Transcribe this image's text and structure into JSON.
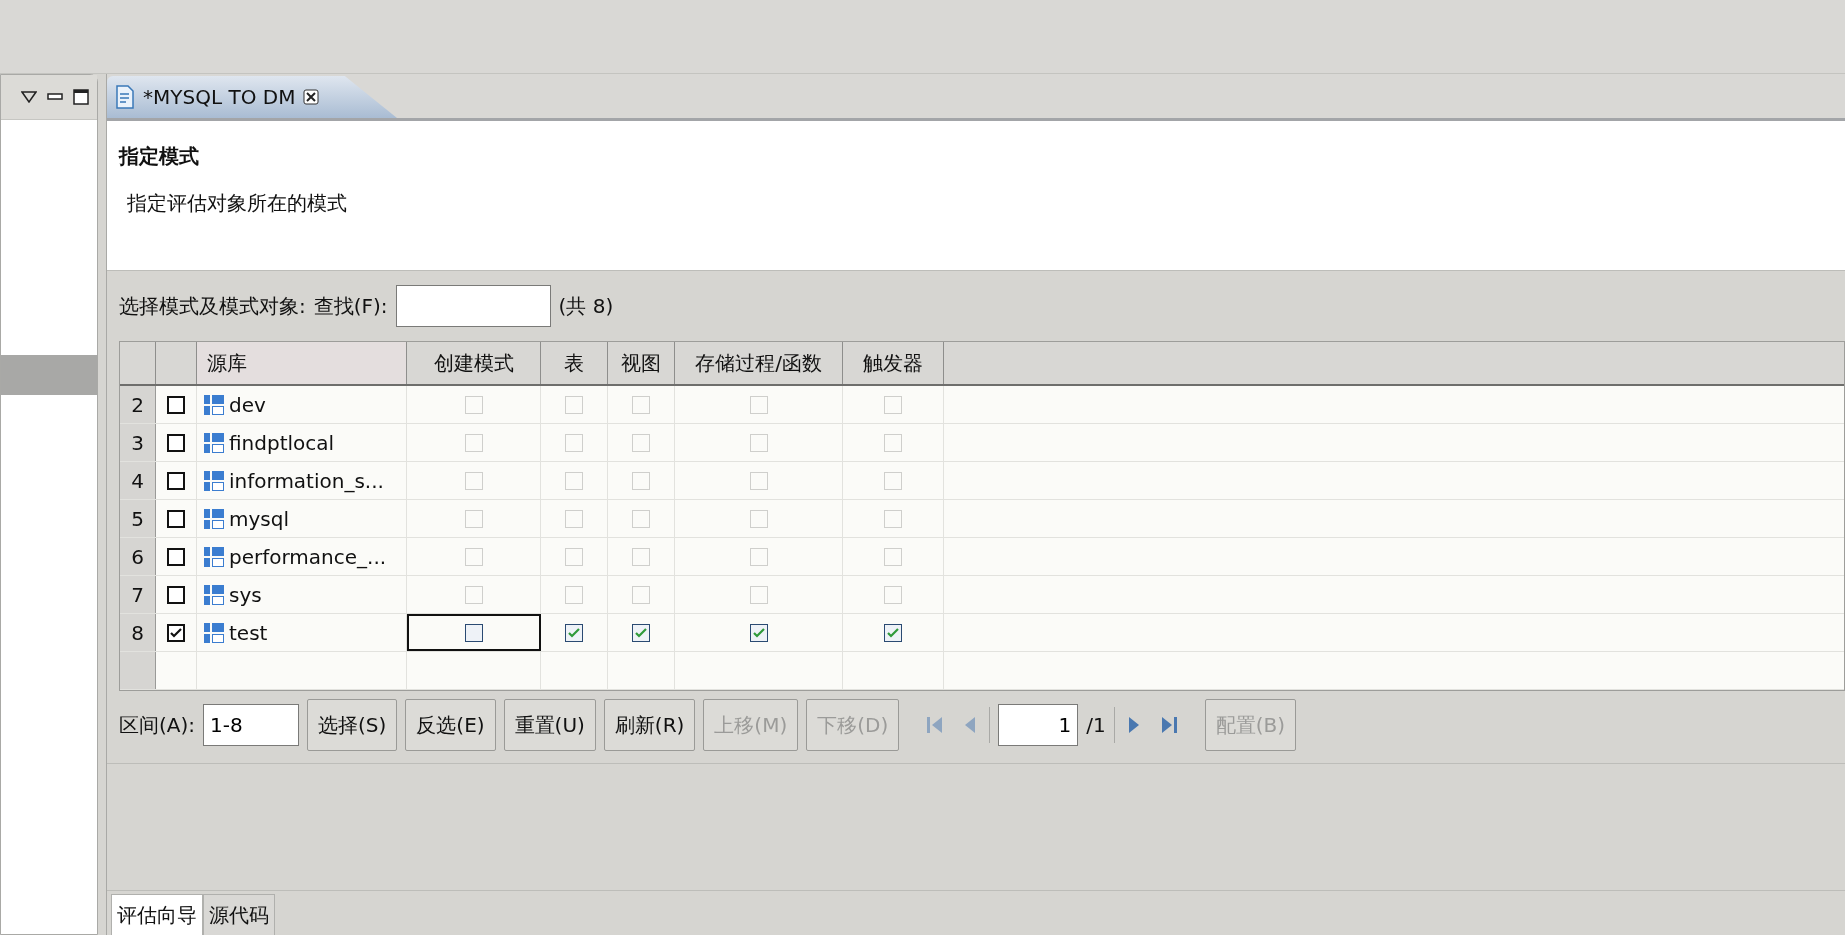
{
  "side_panel": {
    "selected_row": true
  },
  "editor_tab": {
    "title": "*MYSQL TO DM"
  },
  "header": {
    "title": "指定模式",
    "description": "指定评估对象所在的模式"
  },
  "search": {
    "label": "选择模式及模式对象:",
    "find_label": "查找(F):",
    "count": "(共 8)"
  },
  "table": {
    "columns": [
      "源库",
      "创建模式",
      "表",
      "视图",
      "存储过程/函数",
      "触发器"
    ],
    "rows": [
      {
        "number": "2",
        "checked": false,
        "name": "dev",
        "cells": [
          {
            "checked": false,
            "disabled": true,
            "focused": false
          },
          {
            "checked": false,
            "disabled": true,
            "focused": false
          },
          {
            "checked": false,
            "disabled": true,
            "focused": false
          },
          {
            "checked": false,
            "disabled": true,
            "focused": false
          },
          {
            "checked": false,
            "disabled": true,
            "focused": false
          }
        ]
      },
      {
        "number": "3",
        "checked": false,
        "name": "findptlocal",
        "cells": [
          {
            "checked": false,
            "disabled": true,
            "focused": false
          },
          {
            "checked": false,
            "disabled": true,
            "focused": false
          },
          {
            "checked": false,
            "disabled": true,
            "focused": false
          },
          {
            "checked": false,
            "disabled": true,
            "focused": false
          },
          {
            "checked": false,
            "disabled": true,
            "focused": false
          }
        ]
      },
      {
        "number": "4",
        "checked": false,
        "name": "information_s...",
        "cells": [
          {
            "checked": false,
            "disabled": true,
            "focused": false
          },
          {
            "checked": false,
            "disabled": true,
            "focused": false
          },
          {
            "checked": false,
            "disabled": true,
            "focused": false
          },
          {
            "checked": false,
            "disabled": true,
            "focused": false
          },
          {
            "checked": false,
            "disabled": true,
            "focused": false
          }
        ]
      },
      {
        "number": "5",
        "checked": false,
        "name": "mysql",
        "cells": [
          {
            "checked": false,
            "disabled": true,
            "focused": false
          },
          {
            "checked": false,
            "disabled": true,
            "focused": false
          },
          {
            "checked": false,
            "disabled": true,
            "focused": false
          },
          {
            "checked": false,
            "disabled": true,
            "focused": false
          },
          {
            "checked": false,
            "disabled": true,
            "focused": false
          }
        ]
      },
      {
        "number": "6",
        "checked": false,
        "name": "performance_...",
        "cells": [
          {
            "checked": false,
            "disabled": true,
            "focused": false
          },
          {
            "checked": false,
            "disabled": true,
            "focused": false
          },
          {
            "checked": false,
            "disabled": true,
            "focused": false
          },
          {
            "checked": false,
            "disabled": true,
            "focused": false
          },
          {
            "checked": false,
            "disabled": true,
            "focused": false
          }
        ]
      },
      {
        "number": "7",
        "checked": false,
        "name": "sys",
        "cells": [
          {
            "checked": false,
            "disabled": true,
            "focused": false
          },
          {
            "checked": false,
            "disabled": true,
            "focused": false
          },
          {
            "checked": false,
            "disabled": true,
            "focused": false
          },
          {
            "checked": false,
            "disabled": true,
            "focused": false
          },
          {
            "checked": false,
            "disabled": true,
            "focused": false
          }
        ]
      },
      {
        "number": "8",
        "checked": true,
        "name": "test",
        "cells": [
          {
            "checked": false,
            "disabled": false,
            "focused": true
          },
          {
            "checked": true,
            "disabled": false,
            "focused": false
          },
          {
            "checked": true,
            "disabled": false,
            "focused": false
          },
          {
            "checked": true,
            "disabled": false,
            "focused": false
          },
          {
            "checked": true,
            "disabled": false,
            "focused": false
          }
        ]
      }
    ]
  },
  "toolbar": {
    "range_label": "区间(A):",
    "range_value": "1-8",
    "buttons": [
      {
        "label": "选择(S)",
        "disabled": false
      },
      {
        "label": "反选(E)",
        "disabled": false
      },
      {
        "label": "重置(U)",
        "disabled": false
      },
      {
        "label": "刷新(R)",
        "disabled": false
      },
      {
        "label": "上移(M)",
        "disabled": true
      },
      {
        "label": "下移(D)",
        "disabled": true
      }
    ],
    "nav_back_disabled": true,
    "page_value": "1",
    "page_total": "/1",
    "nav_forward_disabled": false,
    "config_button": {
      "label": "配置(B)",
      "disabled": true
    }
  },
  "bottom_tabs": [
    {
      "label": "评估向导",
      "selected": true
    },
    {
      "label": "源代码",
      "selected": false
    }
  ]
}
